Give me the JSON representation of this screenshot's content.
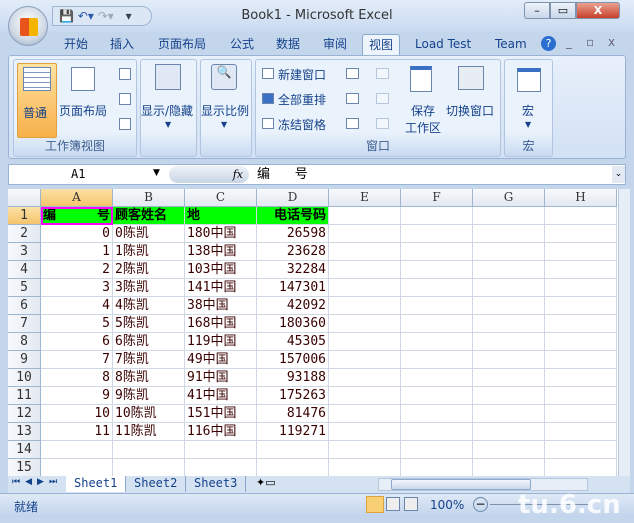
{
  "window": {
    "title": "Book1 - Microsoft Excel",
    "qat": [
      "save-icon",
      "undo-icon",
      "redo-icon",
      "customize-icon"
    ],
    "minimize": "–",
    "restore": "▭",
    "close": "X"
  },
  "ribbon_tabs": [
    "开始",
    "插入",
    "页面布局",
    "公式",
    "数据",
    "审阅",
    "视图",
    "Load Test",
    "Team"
  ],
  "active_tab": "视图",
  "groups": {
    "workbook_views": {
      "label": "工作簿视图",
      "normal": "普通",
      "page_layout": "页面布局"
    },
    "show_hide": {
      "label": "显示/隐藏"
    },
    "zoom": {
      "label": "显示比例"
    },
    "window": {
      "label": "窗口",
      "new_window": "新建窗口",
      "arrange_all": "全部重排",
      "freeze_panes": "冻结窗格",
      "save_workspace_1": "保存",
      "save_workspace_2": "工作区",
      "switch_windows": "切换窗口"
    },
    "macros": {
      "label": "宏",
      "macros": "宏"
    }
  },
  "formula_bar": {
    "name_box": "A1",
    "fx": "fx",
    "value": "编      号"
  },
  "columns": [
    "A",
    "B",
    "C",
    "D",
    "E",
    "F",
    "G",
    "H"
  ],
  "rows": [
    "1",
    "2",
    "3",
    "4",
    "5",
    "6",
    "7",
    "8",
    "9",
    "10",
    "11",
    "12",
    "13",
    "14",
    "15"
  ],
  "header_row": [
    "编",
    "号",
    "顾客姓名",
    "地",
    "电话号码"
  ],
  "data": [
    [
      "0",
      "0陈凯",
      "180中国",
      "26598"
    ],
    [
      "1",
      "1陈凯",
      "138中国",
      "23628"
    ],
    [
      "2",
      "2陈凯",
      "103中国",
      "32284"
    ],
    [
      "3",
      "3陈凯",
      "141中国",
      "147301"
    ],
    [
      "4",
      "4陈凯",
      "38中国",
      "42092"
    ],
    [
      "5",
      "5陈凯",
      "168中国",
      "180360"
    ],
    [
      "6",
      "6陈凯",
      "119中国",
      "45305"
    ],
    [
      "7",
      "7陈凯",
      "49中国",
      "157006"
    ],
    [
      "8",
      "8陈凯",
      "91中国",
      "93188"
    ],
    [
      "9",
      "9陈凯",
      "41中国",
      "175263"
    ],
    [
      "10",
      "10陈凯",
      "151中国",
      "81476"
    ],
    [
      "11",
      "11陈凯",
      "116中国",
      "119271"
    ]
  ],
  "sheets": [
    "Sheet1",
    "Sheet2",
    "Sheet3"
  ],
  "active_sheet": "Sheet1",
  "status": {
    "ready": "就绪",
    "zoom": "100%",
    "watermark": "tu.6.cn"
  },
  "colors": {
    "header_fill": "#00ff00",
    "selection_border": "#ff00ff"
  }
}
